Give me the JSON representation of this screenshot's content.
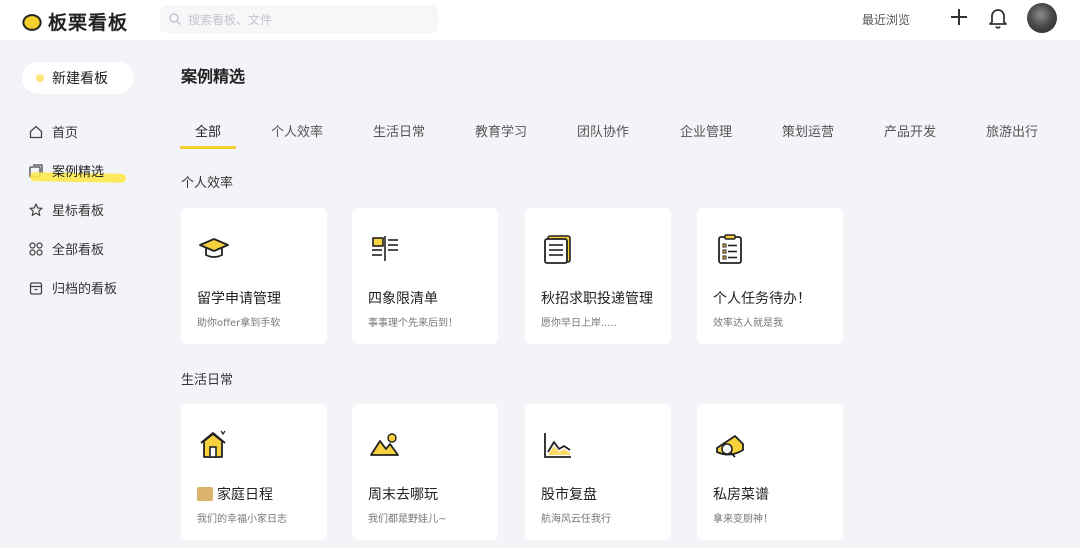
{
  "app": {
    "name": "板栗看板",
    "accent": "#f5cf2a"
  },
  "header": {
    "search_placeholder": "搜索看板、文件",
    "recent_label": "最近浏览"
  },
  "sidebar": {
    "new_board_label": "新建看板",
    "items": [
      {
        "label": "首页",
        "icon": "home-icon"
      },
      {
        "label": "案例精选",
        "icon": "gallery-icon",
        "active": true
      },
      {
        "label": "星标看板",
        "icon": "star-icon"
      },
      {
        "label": "全部看板",
        "icon": "grid-icon"
      },
      {
        "label": "归档的看板",
        "icon": "archive-icon"
      }
    ]
  },
  "main": {
    "title": "案例精选",
    "tabs": [
      "全部",
      "个人效率",
      "生活日常",
      "教育学习",
      "团队协作",
      "企业管理",
      "策划运营",
      "产品开发",
      "旅游出行"
    ],
    "active_tab": 0,
    "sections": [
      {
        "title": "个人效率",
        "cards": [
          {
            "title": "留学申请管理",
            "subtitle": "助你offer拿到手软",
            "icon": "graduation-cap-icon"
          },
          {
            "title": "四象限清单",
            "subtitle": "事事理个先来后到！",
            "icon": "quadrant-list-icon"
          },
          {
            "title": "秋招求职投递管理",
            "subtitle": "愿你早日上岸.....",
            "icon": "document-stack-icon"
          },
          {
            "title": "个人任务待办！",
            "subtitle": "效率达人就是我",
            "icon": "checklist-icon"
          }
        ]
      },
      {
        "title": "生活日常",
        "cards": [
          {
            "title": "家庭日程",
            "subtitle": "我们的幸福小家日志",
            "icon": "house-icon"
          },
          {
            "title": "周末去哪玩",
            "subtitle": "我们都是野娃儿~",
            "icon": "mountain-sun-icon"
          },
          {
            "title": "股市复盘",
            "subtitle": "航海风云任我行",
            "icon": "stock-chart-icon"
          },
          {
            "title": "私房菜谱",
            "subtitle": "拿来变厨神！",
            "icon": "cheese-icon"
          }
        ]
      }
    ]
  }
}
